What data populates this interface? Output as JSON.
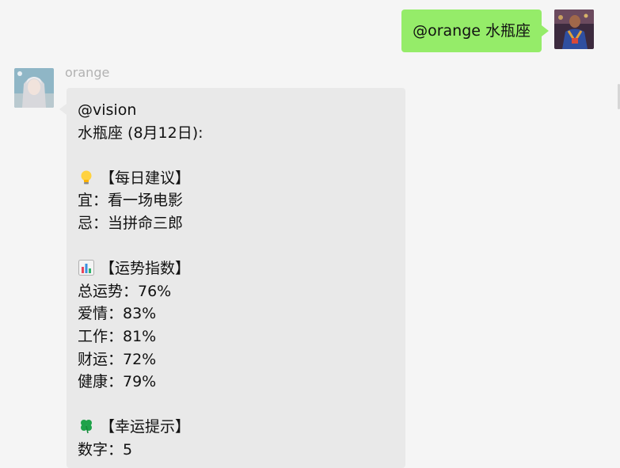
{
  "outgoing": {
    "text": "@orange 水瓶座"
  },
  "incoming": {
    "sender": "orange",
    "lines": {
      "mention": "@vision",
      "sign": "水瓶座 (8月12日):",
      "advice_header": "【每日建议】",
      "advice_do": "宜：看一场电影",
      "advice_avoid": "忌：当拼命三郎",
      "fortune_header": "【运势指数】",
      "fortune_total": "总运势：76%",
      "fortune_love": "爱情：83%",
      "fortune_work": "工作：81%",
      "fortune_wealth": "财运：72%",
      "fortune_health": "健康：79%",
      "luck_header": "【幸运提示】",
      "luck_number": "数字：5"
    }
  },
  "icons": {
    "advice": "lightbulb-icon",
    "fortune": "bar-chart-icon",
    "luck": "four-leaf-clover-icon"
  },
  "colors": {
    "background": "#f5f5f5",
    "outgoing_bubble": "#95ec69",
    "incoming_bubble": "#e9e9e9",
    "sender_name": "#b2b2b2"
  }
}
